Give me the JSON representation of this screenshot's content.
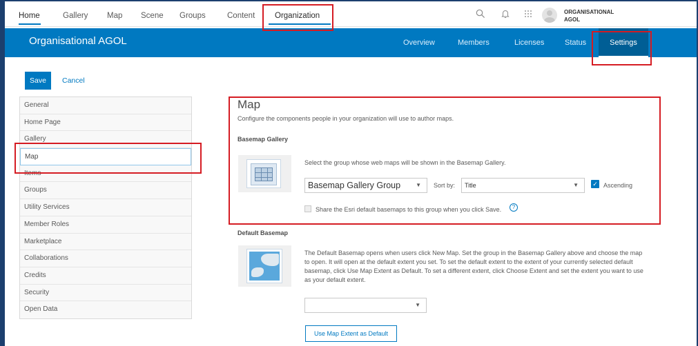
{
  "topnav": {
    "items": [
      "Home",
      "Gallery",
      "Map",
      "Scene",
      "Groups",
      "Content",
      "Organization"
    ],
    "user_name": "ORGANISATIONAL AGOL",
    "icons": [
      "search-icon",
      "bell-icon",
      "apps-grid-icon",
      "avatar"
    ]
  },
  "header": {
    "org_title": "Organisational AGOL",
    "tabs": [
      "Overview",
      "Members",
      "Licenses",
      "Status",
      "Settings"
    ],
    "active_tab": "Settings",
    "accent_color": "#0079c1"
  },
  "actions": {
    "save_label": "Save",
    "cancel_label": "Cancel"
  },
  "sidebar": {
    "items": [
      "General",
      "Home Page",
      "Gallery",
      "Map",
      "Items",
      "Groups",
      "Utility Services",
      "Member Roles",
      "Marketplace",
      "Collaborations",
      "Credits",
      "Security",
      "Open Data"
    ],
    "selected": "Map"
  },
  "main": {
    "title": "Map",
    "description": "Configure the components people in your organization will use to author maps.",
    "basemap_gallery": {
      "heading": "Basemap Gallery",
      "text": "Select the group whose web maps will be shown in the Basemap Gallery.",
      "group_value": "Basemap Gallery Group",
      "sort_label": "Sort by:",
      "sort_value": "Title",
      "ascending_label": "Ascending",
      "ascending_checked": true,
      "share_label": "Share the Esri default basemaps to this group when you click Save.",
      "share_checked": false,
      "help_glyph": "?"
    },
    "default_basemap": {
      "heading": "Default Basemap",
      "text": "The Default Basemap opens when users click New Map. Set the group in the Basemap Gallery above and choose the map to open. It will open at the default extent you set. To set the default extent to the extent of your currently selected default basemap, click Use Map Extent as Default. To set a different extent, click Choose Extent and set the extent you want to use as your default extent.",
      "select_value": "",
      "button_label": "Use Map Extent as Default"
    }
  },
  "highlight_color": "#d51b22"
}
